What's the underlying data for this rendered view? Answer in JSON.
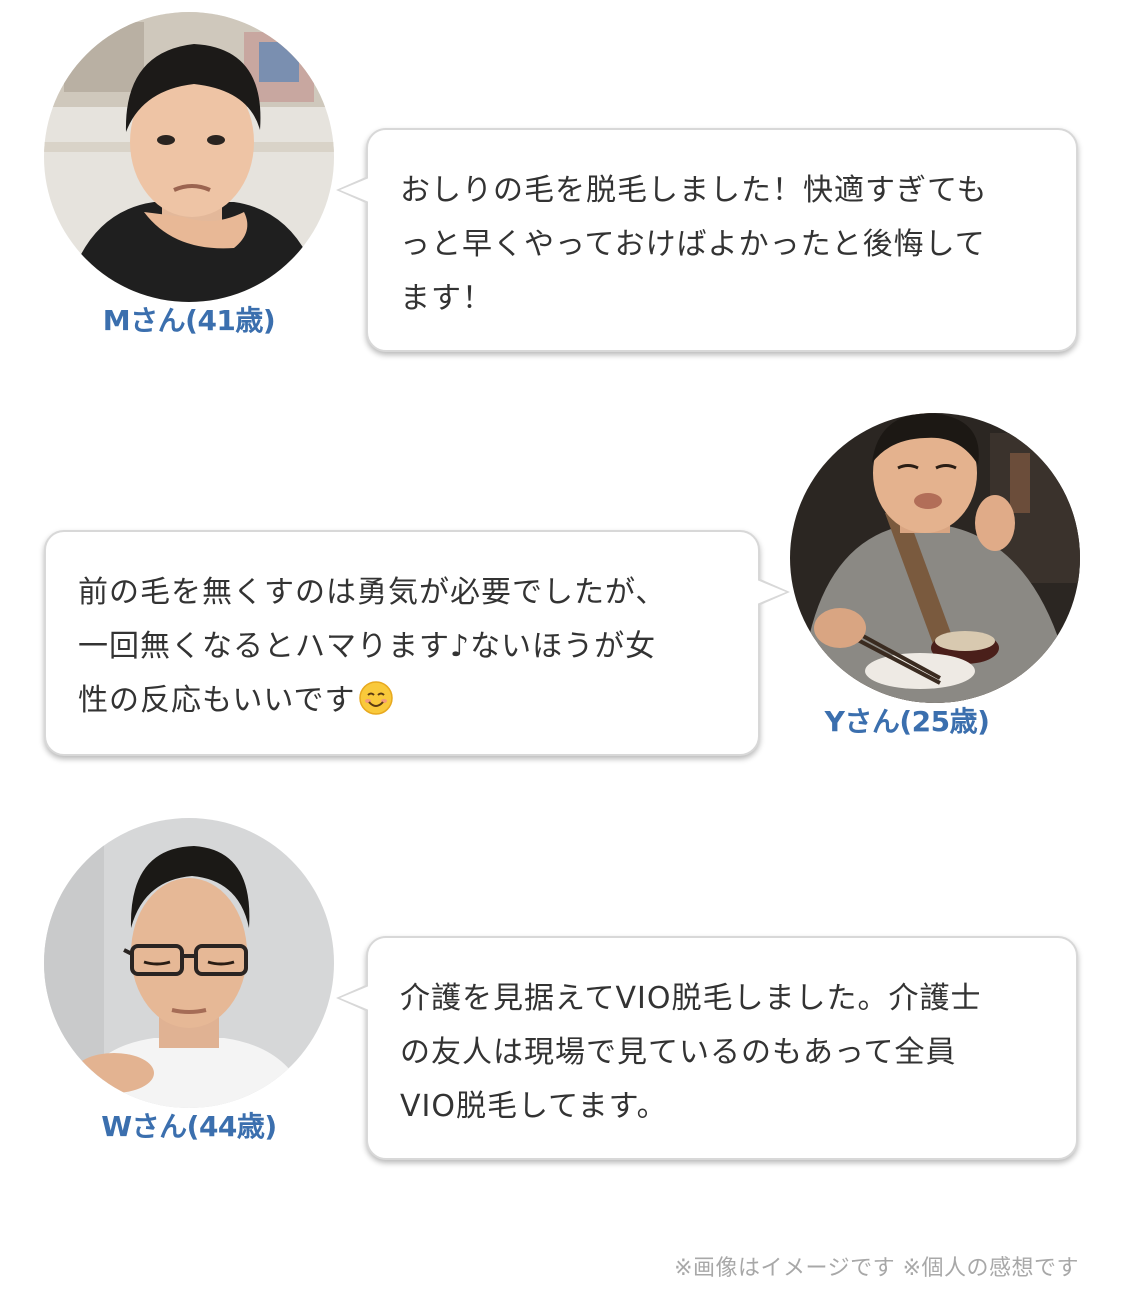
{
  "testimonials": [
    {
      "name": "Mさん(41歳)",
      "avatar_icon": "man-portrait-photo",
      "comment": "おしりの毛を脱毛しました！快適すぎても\nっと早くやっておけばよかったと後悔して\nます！"
    },
    {
      "name": "Yさん(25歳)",
      "avatar_icon": "man-eating-portrait-photo",
      "comment": "前の毛を無くすのは勇気が必要でしたが、\n一回無くなるとハマります♪ないほうが女\n性の反応もいいです",
      "emoji_icon": "smiling-face-emoji"
    },
    {
      "name": "Wさん(44歳)",
      "avatar_icon": "man-with-glasses-portrait-photo",
      "comment": "介護を見据えてVIO脱毛しました。介護士\nの友人は現場で見ているのもあって全員\nVIO脱毛してます。"
    }
  ],
  "footer_note": "※画像はイメージです ※個人の感想です",
  "colors": {
    "name_text": "#3b6fae",
    "body_text": "#333333",
    "bubble_border": "#d8d8d8",
    "note_text": "#a8a8a8"
  }
}
